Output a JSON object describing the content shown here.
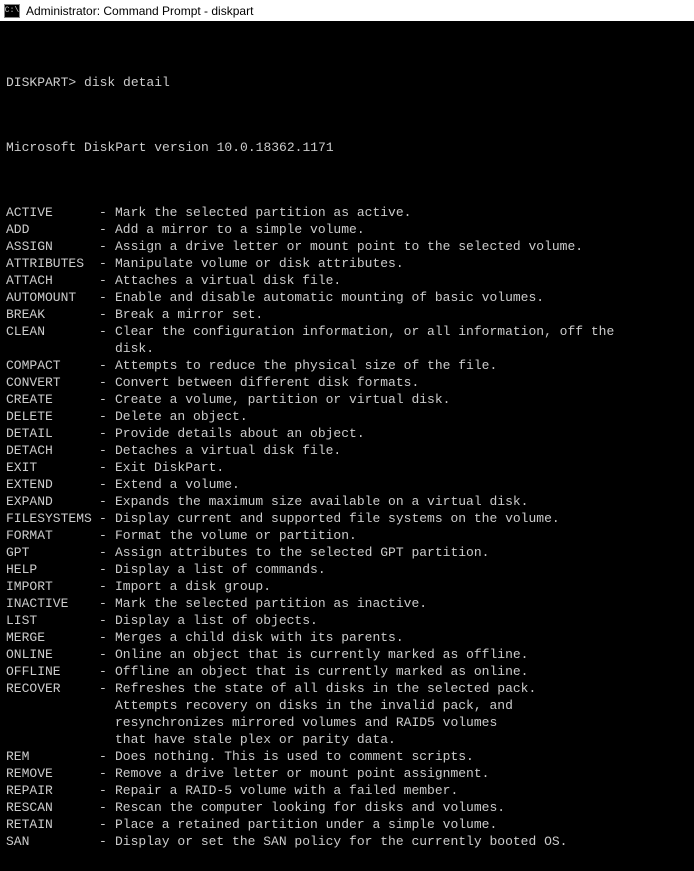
{
  "window": {
    "title": "Administrator: Command Prompt - diskpart",
    "icon_label": "C:\\"
  },
  "terminal": {
    "prompt": "DISKPART> ",
    "command": "disk detail",
    "version_line": "Microsoft DiskPart version 10.0.18362.1171",
    "commands": [
      {
        "name": "ACTIVE",
        "desc": "Mark the selected partition as active."
      },
      {
        "name": "ADD",
        "desc": "Add a mirror to a simple volume."
      },
      {
        "name": "ASSIGN",
        "desc": "Assign a drive letter or mount point to the selected volume."
      },
      {
        "name": "ATTRIBUTES",
        "desc": "Manipulate volume or disk attributes."
      },
      {
        "name": "ATTACH",
        "desc": "Attaches a virtual disk file."
      },
      {
        "name": "AUTOMOUNT",
        "desc": "Enable and disable automatic mounting of basic volumes."
      },
      {
        "name": "BREAK",
        "desc": "Break a mirror set."
      },
      {
        "name": "CLEAN",
        "desc": "Clear the configuration information, or all information, off the",
        "cont": [
          "disk."
        ]
      },
      {
        "name": "COMPACT",
        "desc": "Attempts to reduce the physical size of the file."
      },
      {
        "name": "CONVERT",
        "desc": "Convert between different disk formats."
      },
      {
        "name": "CREATE",
        "desc": "Create a volume, partition or virtual disk."
      },
      {
        "name": "DELETE",
        "desc": "Delete an object."
      },
      {
        "name": "DETAIL",
        "desc": "Provide details about an object."
      },
      {
        "name": "DETACH",
        "desc": "Detaches a virtual disk file."
      },
      {
        "name": "EXIT",
        "desc": "Exit DiskPart."
      },
      {
        "name": "EXTEND",
        "desc": "Extend a volume."
      },
      {
        "name": "EXPAND",
        "desc": "Expands the maximum size available on a virtual disk."
      },
      {
        "name": "FILESYSTEMS",
        "desc": "Display current and supported file systems on the volume."
      },
      {
        "name": "FORMAT",
        "desc": "Format the volume or partition."
      },
      {
        "name": "GPT",
        "desc": "Assign attributes to the selected GPT partition."
      },
      {
        "name": "HELP",
        "desc": "Display a list of commands."
      },
      {
        "name": "IMPORT",
        "desc": "Import a disk group."
      },
      {
        "name": "INACTIVE",
        "desc": "Mark the selected partition as inactive."
      },
      {
        "name": "LIST",
        "desc": "Display a list of objects."
      },
      {
        "name": "MERGE",
        "desc": "Merges a child disk with its parents."
      },
      {
        "name": "ONLINE",
        "desc": "Online an object that is currently marked as offline."
      },
      {
        "name": "OFFLINE",
        "desc": "Offline an object that is currently marked as online."
      },
      {
        "name": "RECOVER",
        "desc": "Refreshes the state of all disks in the selected pack.",
        "cont": [
          "Attempts recovery on disks in the invalid pack, and",
          "resynchronizes mirrored volumes and RAID5 volumes",
          "that have stale plex or parity data."
        ]
      },
      {
        "name": "REM",
        "desc": "Does nothing. This is used to comment scripts."
      },
      {
        "name": "REMOVE",
        "desc": "Remove a drive letter or mount point assignment."
      },
      {
        "name": "REPAIR",
        "desc": "Repair a RAID-5 volume with a failed member."
      },
      {
        "name": "RESCAN",
        "desc": "Rescan the computer looking for disks and volumes."
      },
      {
        "name": "RETAIN",
        "desc": "Place a retained partition under a simple volume."
      },
      {
        "name": "SAN",
        "desc": "Display or set the SAN policy for the currently booted OS."
      }
    ]
  }
}
